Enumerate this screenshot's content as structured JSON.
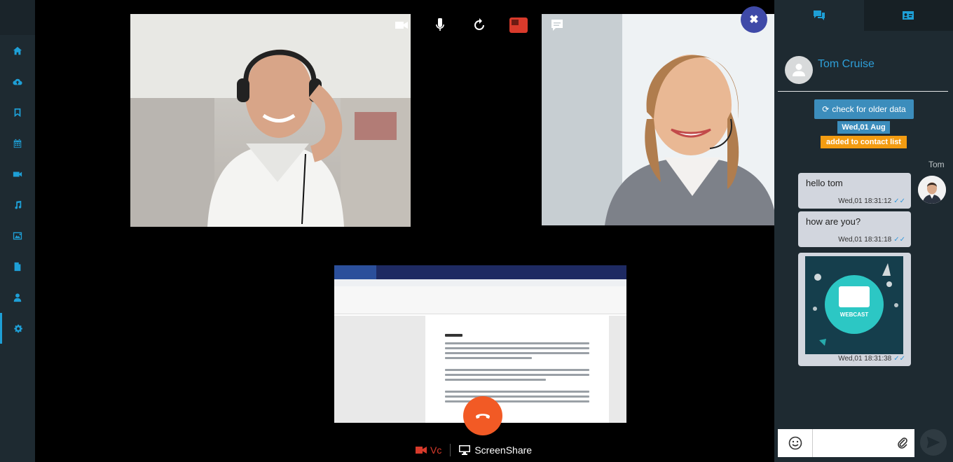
{
  "sidebar": {
    "items": [
      {
        "icon": "home-icon"
      },
      {
        "icon": "cloud-upload-icon"
      },
      {
        "icon": "bookmark-icon"
      },
      {
        "icon": "calendar-icon"
      },
      {
        "icon": "video-icon"
      },
      {
        "icon": "music-icon"
      },
      {
        "icon": "image-icon"
      },
      {
        "icon": "file-icon"
      },
      {
        "icon": "user-icon"
      },
      {
        "icon": "settings-icon"
      }
    ],
    "accent": "#1e9fd6"
  },
  "call": {
    "toolbar": [
      "video-camera-icon",
      "microphone-icon",
      "refresh-icon",
      "record-icon",
      "chat-bubble-icon"
    ],
    "close_label": "✖",
    "modes": {
      "vc_label": "Vc",
      "share_label": "ScreenShare"
    },
    "hangup_color": "#f25a25"
  },
  "chat": {
    "tabs": [
      "chat-icon",
      "contact-card-icon"
    ],
    "contact_name": "Tom Cruise",
    "older_button_label": "check for older data",
    "date_badge": "Wed,01 Aug",
    "added_badge": "added to contact list",
    "sender_name": "Tom",
    "messages": [
      {
        "text": "hello tom",
        "time": "Wed,01 18:31:12"
      },
      {
        "text": "how are you?",
        "time": "Wed,01 18:31:18"
      },
      {
        "image_label": "WEBCAST",
        "time": "Wed,01 18:31:38"
      }
    ],
    "input_placeholder": ""
  },
  "colors": {
    "panel": "#1e2a31",
    "badge_blue": "#3c8dbc",
    "badge_orange": "#f39c12",
    "contact_name": "#2e9fd8"
  }
}
